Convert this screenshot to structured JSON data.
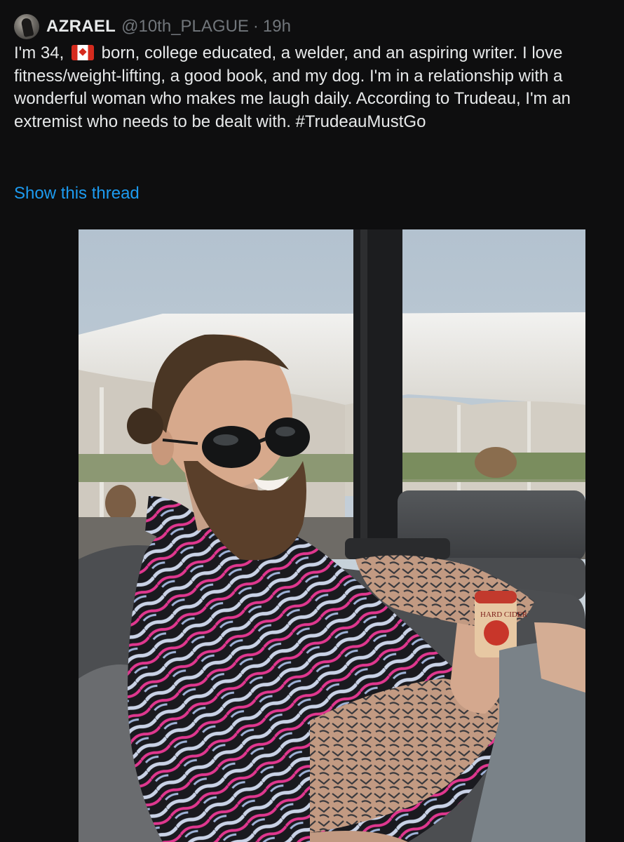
{
  "tweet": {
    "author_name": "AZRAEL",
    "author_handle": "@10th_PLAGUE",
    "separator": "·",
    "timestamp": "19h",
    "text_before_flag": "I'm 34, ",
    "flag_icon": "canada-flag-icon",
    "text_after_flag": " born, college educated, a welder, and an aspiring writer. I love fitness/weight-lifting, a good book, and my dog. I'm in a relationship with a wonderful woman who makes me laugh daily. According to Trudeau, I'm an extremist who needs to be dealt with. #TrudeauMustGo",
    "show_thread_label": "Show this thread",
    "can_label": "HARD CIDER"
  },
  "colors": {
    "background": "#0e0e0f",
    "text": "#e7e9ea",
    "muted": "#71767b",
    "link": "#1d9bf0"
  }
}
